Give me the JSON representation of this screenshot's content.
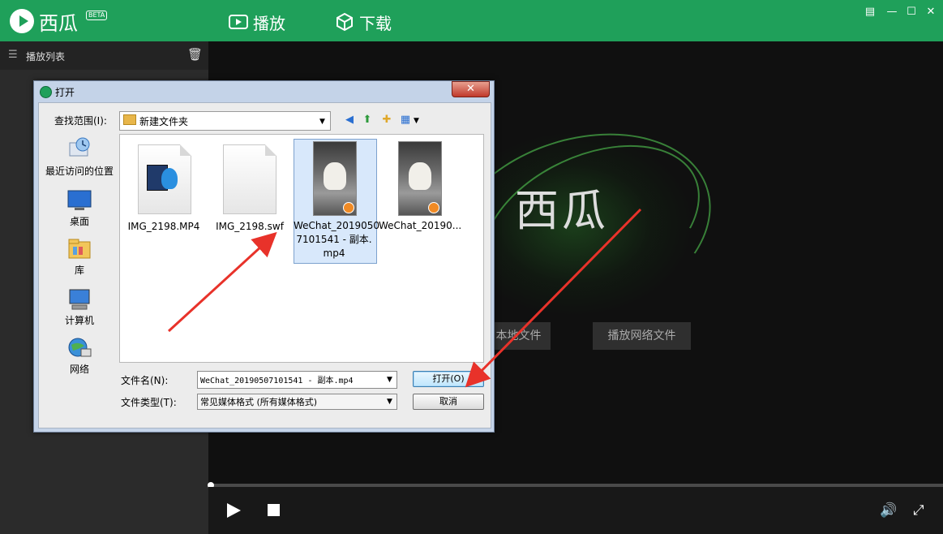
{
  "app": {
    "name": "西瓜",
    "badge": "BETA",
    "tabs": [
      {
        "label": "播放",
        "icon": "play-tab-icon"
      },
      {
        "label": "下载",
        "icon": "download-tab-icon"
      }
    ],
    "window_controls": [
      "menu-icon",
      "minimize-icon",
      "maximize-icon",
      "close-icon"
    ]
  },
  "playlist": {
    "title": "播放列表"
  },
  "player": {
    "brand": "西瓜",
    "btn_local": "本地文件",
    "btn_network": "播放网络文件"
  },
  "dialog": {
    "title": "打开",
    "close": "✕",
    "lookin_label": "查找范围(I):",
    "lookin_value": "新建文件夹",
    "places": [
      {
        "label": "最近访问的位置",
        "icon": "recent-places-icon"
      },
      {
        "label": "桌面",
        "icon": "desktop-icon"
      },
      {
        "label": "库",
        "icon": "libraries-icon"
      },
      {
        "label": "计算机",
        "icon": "computer-icon"
      },
      {
        "label": "网络",
        "icon": "network-icon"
      }
    ],
    "files": [
      {
        "name": "IMG_2198.MP4",
        "type": "media"
      },
      {
        "name": "IMG_2198.swf",
        "type": "blank"
      },
      {
        "name": "WeChat_20190507101541 - 副本.mp4",
        "line1": "WeChat_2019050",
        "line2": "7101541 - 副本.",
        "line3": "mp4",
        "type": "video",
        "selected": true
      },
      {
        "name": "WeChat_20190...",
        "type": "video"
      }
    ],
    "filename_label": "文件名(N):",
    "filename_value": "WeChat_20190507101541 - 副本.mp4",
    "filetype_label": "文件类型(T):",
    "filetype_value": "常见媒体格式 (所有媒体格式)",
    "open_button": "打开(O)",
    "cancel_button": "取消"
  },
  "colors": {
    "brand_green": "#1fa05a",
    "annotation_red": "#e8322a"
  }
}
